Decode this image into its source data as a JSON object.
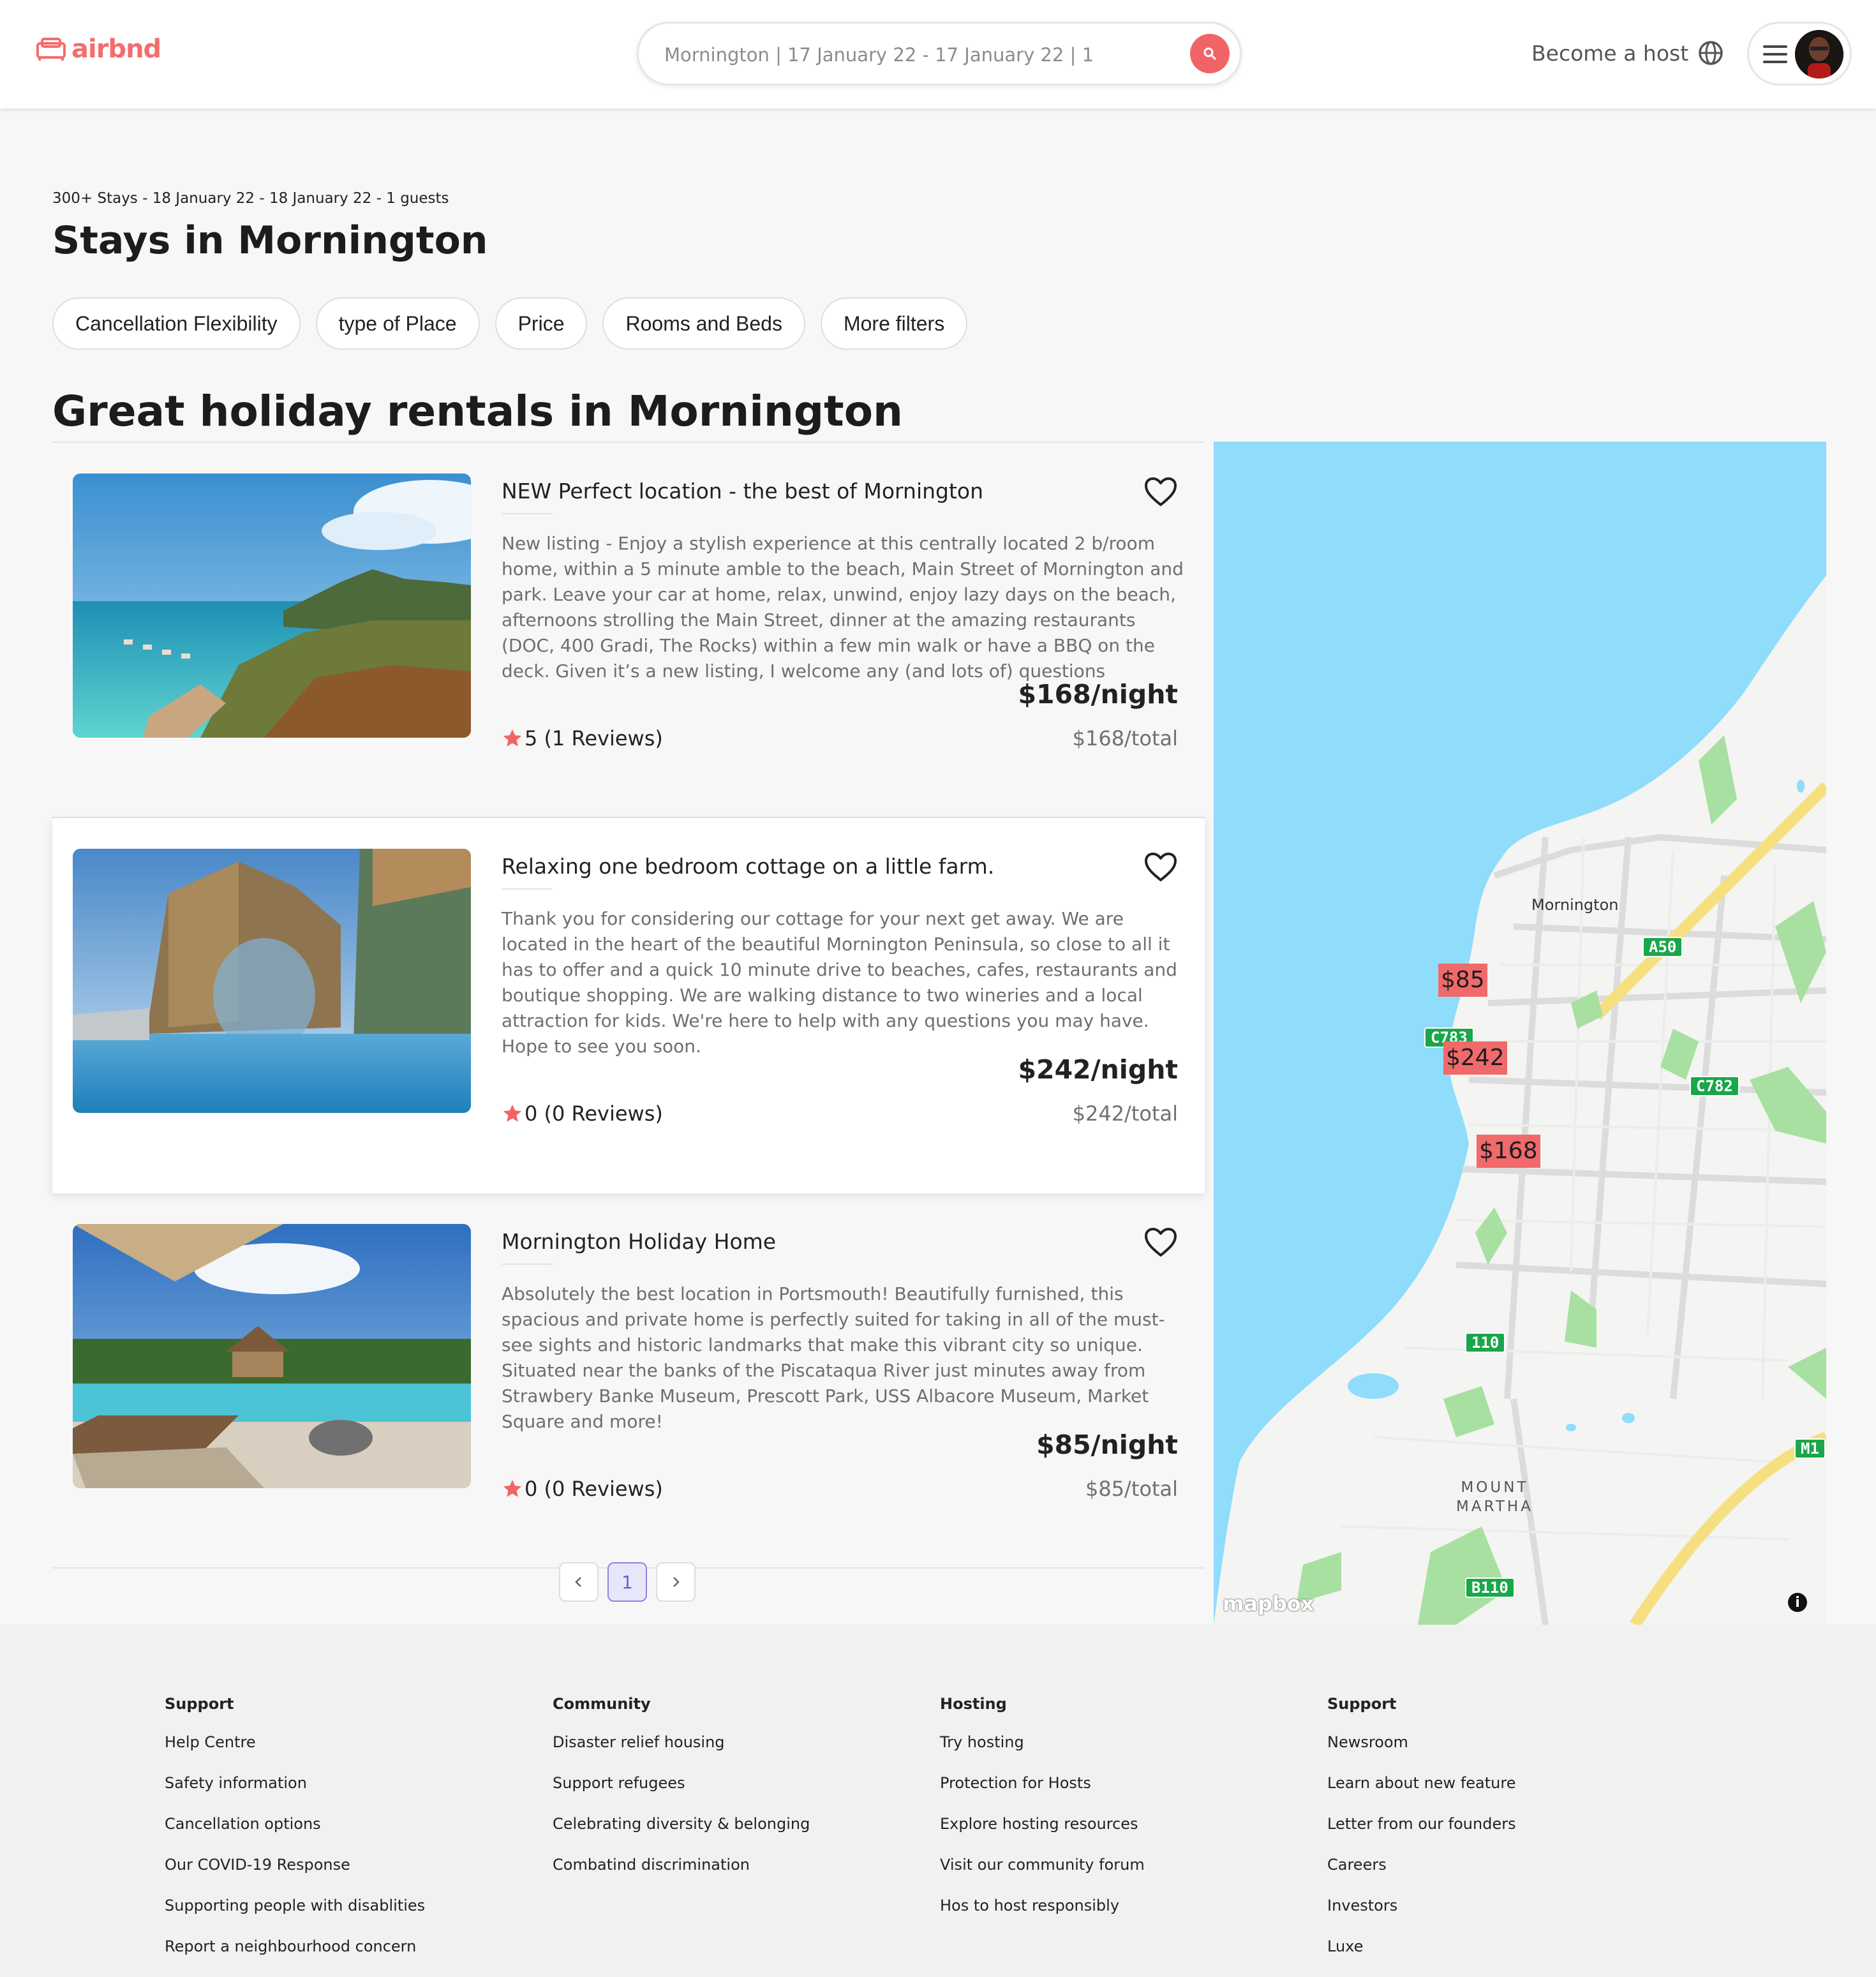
{
  "header": {
    "logo_text": "airbnd",
    "search_text": "Mornington | 17 January 22 - 17 January 22 | 1",
    "become_host": "Become a host"
  },
  "results": {
    "summary": "300+ Stays - 18 January 22 - 18 January 22 - 1 guests",
    "title": "Stays in Mornington",
    "filters": [
      "Cancellation Flexibility",
      "type of Place",
      "Price",
      "Rooms and Beds",
      "More filters"
    ],
    "section_title": "Great holiday rentals in Mornington"
  },
  "listings": [
    {
      "title": "NEW Perfect location - the best of Mornington",
      "description": "New listing - Enjoy a stylish experience at this centrally located 2 b/room home, within a 5 minute amble to the beach, Main Street of Mornington and park. Leave your car at home, relax, unwind, enjoy lazy days on the beach, afternoons strolling the Main Street, dinner at the amazing restaurants (DOC, 400 Gradi, The Rocks) within a few min walk or have a BBQ on the deck. Given it’s a new listing, I welcome any (and lots of) questions",
      "price": "$168/night",
      "total": "$168/total",
      "rating": "5 (1 Reviews)"
    },
    {
      "title": "Relaxing one bedroom cottage on a little farm.",
      "description": "Thank you for considering our cottage for your next get away. We are located in the heart of the beautiful Mornington Peninsula, so close to all it has to offer and a quick 10 minute drive to beaches, cafes, restaurants and boutique shopping. We are walking distance to two wineries and a local attraction for kids. We're here to help with any questions you may have. Hope to see you soon.",
      "price": "$242/night",
      "total": "$242/total",
      "rating": "0 (0 Reviews)"
    },
    {
      "title": "Mornington Holiday Home",
      "description": "Absolutely the best location in Portsmouth! Beautifully furnished, this spacious and private home is perfectly suited for taking in all of the must-see sights and historic landmarks that make this vibrant city so unique. Situated near the banks of the Piscataqua River just minutes away from Strawbery Banke Museum, Prescott Park, USS Albacore Museum, Market Square and more!",
      "price": "$85/night",
      "total": "$85/total",
      "rating": "0 (0 Reviews)"
    }
  ],
  "pagination": {
    "current": "1"
  },
  "map": {
    "pins": [
      "$85",
      "$242",
      "$168"
    ],
    "labels": {
      "town": "Mornington",
      "suburb_line1": "MOUNT",
      "suburb_line2": "MARTHA"
    },
    "roads": [
      "A50",
      "C783",
      "C782",
      "B110",
      "M1",
      "110"
    ],
    "attribution": "mapbox",
    "info": "i"
  },
  "footer": {
    "columns": [
      {
        "heading": "Support",
        "links": [
          "Help Centre",
          "Safety information",
          "Cancellation options",
          "Our COVID-19 Response",
          "Supporting people with disablities",
          "Report a neighbourhood concern"
        ]
      },
      {
        "heading": "Community",
        "links": [
          "Disaster relief housing",
          "Support refugees",
          "Celebrating diversity & belonging",
          "Combatind discrimination"
        ]
      },
      {
        "heading": "Hosting",
        "links": [
          "Try hosting",
          "Protection for Hosts",
          "Explore hosting resources",
          "Visit our community forum",
          "Hos to host responsibly"
        ]
      },
      {
        "heading": "Support",
        "links": [
          "Newsroom",
          "Learn about new feature",
          "Letter from our founders",
          "Careers",
          "Investors",
          "Luxe"
        ]
      }
    ]
  },
  "colors": {
    "brand": "#f26d6d",
    "pin": "#f0696b",
    "water": "#8fdcfb",
    "road_badge": "#1aa64b"
  },
  "icons": [
    "airbnd-logo-icon",
    "search-icon",
    "globe-icon",
    "menu-icon",
    "heart-icon",
    "star-icon",
    "chevron-left-icon",
    "chevron-right-icon",
    "info-icon"
  ]
}
